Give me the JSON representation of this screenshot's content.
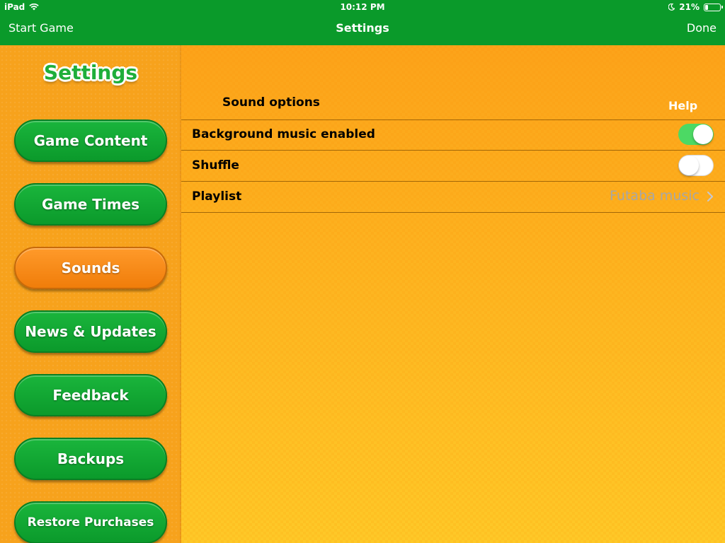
{
  "status_bar": {
    "device": "iPad",
    "time": "10:12 PM",
    "battery_percent": "21%",
    "battery_level": 0.21,
    "wifi_icon": "wifi-icon",
    "do_not_disturb_icon": "moon-icon"
  },
  "nav": {
    "left_label": "Start Game",
    "title": "Settings",
    "right_label": "Done"
  },
  "sidebar": {
    "logo_text": "Settings",
    "items": [
      {
        "label": "Game Content",
        "active": false
      },
      {
        "label": "Game Times",
        "active": false
      },
      {
        "label": "Sounds",
        "active": true
      },
      {
        "label": "News & Updates",
        "active": false
      },
      {
        "label": "Feedback",
        "active": false
      },
      {
        "label": "Backups",
        "active": false
      },
      {
        "label": "Restore Purchases",
        "active": false
      }
    ]
  },
  "main": {
    "section_title": "Sound options",
    "help_label": "Help",
    "rows": [
      {
        "label": "Background music enabled",
        "toggle": true
      },
      {
        "label": "Shuffle",
        "toggle": false
      },
      {
        "label": "Playlist",
        "value": "Futaba music"
      }
    ]
  },
  "colors": {
    "nav_green": "#0a9a2a",
    "button_green": "#1ab53c",
    "button_active_orange": "#f58a15",
    "toggle_on": "#4cd964",
    "background_orange": "#fdb31e"
  }
}
